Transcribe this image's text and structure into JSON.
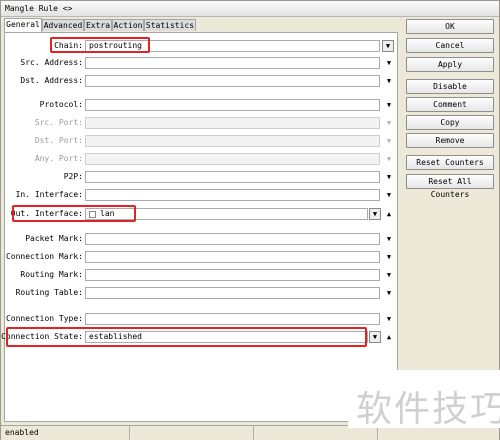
{
  "window": {
    "title": "Mangle Rule <>"
  },
  "tabs": [
    {
      "label": "General",
      "active": true
    },
    {
      "label": "Advanced",
      "active": false
    },
    {
      "label": "Extra",
      "active": false
    },
    {
      "label": "Action",
      "active": false
    },
    {
      "label": "Statistics",
      "active": false
    }
  ],
  "fields": {
    "chain": {
      "label": "Chain:",
      "value": "postrouting"
    },
    "src_address": {
      "label": "Src. Address:",
      "value": ""
    },
    "dst_address": {
      "label": "Dst. Address:",
      "value": ""
    },
    "protocol": {
      "label": "Protocol:",
      "value": ""
    },
    "src_port": {
      "label": "Src. Port:",
      "value": ""
    },
    "dst_port": {
      "label": "Dst. Port:",
      "value": ""
    },
    "any_port": {
      "label": "Any. Port:",
      "value": ""
    },
    "p2p": {
      "label": "P2P:",
      "value": ""
    },
    "in_interface": {
      "label": "In. Interface:",
      "value": ""
    },
    "out_interface": {
      "label": "Out. Interface:",
      "value": "lan"
    },
    "packet_mark": {
      "label": "Packet Mark:",
      "value": ""
    },
    "connection_mark": {
      "label": "Connection Mark:",
      "value": ""
    },
    "routing_mark": {
      "label": "Routing Mark:",
      "value": ""
    },
    "routing_table": {
      "label": "Routing Table:",
      "value": ""
    },
    "connection_type": {
      "label": "Connection Type:",
      "value": ""
    },
    "connection_state": {
      "label": "Connection State:",
      "value": "established"
    }
  },
  "buttons": {
    "ok": "OK",
    "cancel": "Cancel",
    "apply": "Apply",
    "disable": "Disable",
    "comment": "Comment",
    "copy": "Copy",
    "remove": "Remove",
    "reset_counters": "Reset Counters",
    "reset_all_counters": "Reset All Counters"
  },
  "status": {
    "text": "enabled"
  },
  "watermark": {
    "text": "软件技巧"
  },
  "colors": {
    "highlight": "#e02424",
    "window_bg": "#ece9d8"
  },
  "icons": {
    "dropdown": "triangle-down",
    "expand": "triangle-up"
  }
}
